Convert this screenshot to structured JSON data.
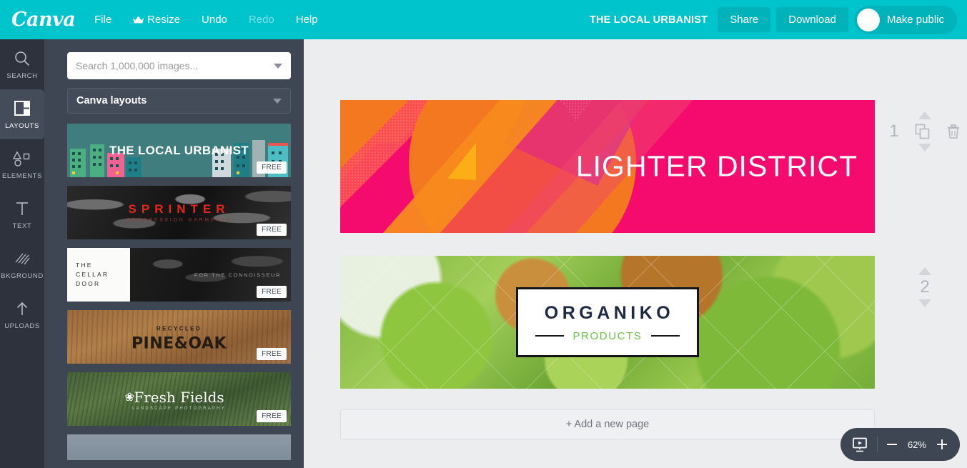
{
  "topbar": {
    "logo": "Canva",
    "menu": [
      {
        "label": "File",
        "icon": null,
        "dim": false
      },
      {
        "label": "Resize",
        "icon": "crown-icon",
        "dim": false
      },
      {
        "label": "Undo",
        "icon": null,
        "dim": false
      },
      {
        "label": "Redo",
        "icon": null,
        "dim": true
      },
      {
        "label": "Help",
        "icon": null,
        "dim": false
      }
    ],
    "doc_title": "THE LOCAL URBANIST",
    "share_label": "Share",
    "download_label": "Download",
    "make_public_label": "Make public",
    "brand_color": "#00c4cc",
    "button_color": "#00b3ba"
  },
  "rail": {
    "items": [
      {
        "label": "SEARCH",
        "icon": "search-icon",
        "active": false
      },
      {
        "label": "LAYOUTS",
        "icon": "layouts-icon",
        "active": true
      },
      {
        "label": "ELEMENTS",
        "icon": "elements-icon",
        "active": false
      },
      {
        "label": "TEXT",
        "icon": "text-icon",
        "active": false
      },
      {
        "label": "BKGROUND",
        "icon": "background-icon",
        "active": false
      },
      {
        "label": "UPLOADS",
        "icon": "uploads-icon",
        "active": false
      }
    ]
  },
  "panel": {
    "search": {
      "value": "",
      "placeholder": "Search 1,000,000 images...",
      "icon": "chevron-down-icon"
    },
    "category_select": {
      "value": "Canva layouts",
      "icon": "chevron-down-icon"
    },
    "badge_label": "FREE",
    "thumbnails": [
      {
        "name": "the-local-urbanist",
        "title": "THE LOCAL URBANIST",
        "subtitle": "",
        "badge": "FREE"
      },
      {
        "name": "sprinter",
        "title": "SPRINTER",
        "subtitle": "COMPRESSION GARMENTS",
        "badge": "FREE"
      },
      {
        "name": "the-cellar-door",
        "title": "THE\nCELLAR\nDOOR",
        "subtitle": "FOR THE CONNOISSEUR",
        "badge": "FREE"
      },
      {
        "name": "recycled-pine-and-oak",
        "title": "PINE&OAK",
        "subtitle": "RECYCLED",
        "badge": "FREE"
      },
      {
        "name": "fresh-fields",
        "title": "Fresh Fields",
        "subtitle": "LANDSCAPE PHOTOGRAPHY",
        "badge": "FREE"
      },
      {
        "name": "partial-thumbnail",
        "title": "",
        "subtitle": "",
        "badge": ""
      }
    ]
  },
  "canvas": {
    "pages": [
      {
        "number": "1",
        "design_name": "lighter-district-banner",
        "title": "LIGHTER DISTRICT",
        "colors": {
          "background": "#f50a6e",
          "circle": "#f4781f",
          "magenta": "#cf21a6"
        }
      },
      {
        "number": "2",
        "design_name": "organiko-products-banner",
        "title": "ORGANIKO",
        "subtitle": "PRODUCTS",
        "colors": {
          "title": "#1e2a44",
          "subtitle": "#6fc04a",
          "border": "#14161b"
        }
      }
    ],
    "page_tools": [
      {
        "name": "move-page-up",
        "icon": "triangle-up-icon"
      },
      {
        "name": "duplicate-page",
        "icon": "copy-icon"
      },
      {
        "name": "delete-page",
        "icon": "trash-icon"
      },
      {
        "name": "move-page-down",
        "icon": "triangle-down-icon"
      }
    ],
    "add_page_label": "+ Add a new page"
  },
  "zoombar": {
    "present_icon": "presentation-icon",
    "minus_icon": "minus-icon",
    "plus_icon": "plus-icon",
    "zoom_level": "62%"
  }
}
